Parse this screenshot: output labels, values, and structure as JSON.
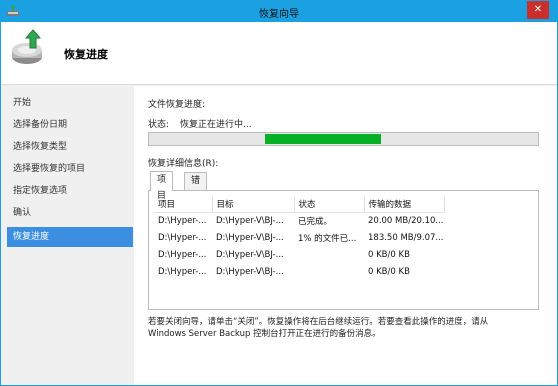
{
  "window": {
    "title": "恢复向导",
    "close_glyph": "✕"
  },
  "header": {
    "title": "恢复进度",
    "icon": "backup-restore-icon"
  },
  "sidebar": {
    "items": [
      {
        "label": "开始",
        "active": false
      },
      {
        "label": "选择备份日期",
        "active": false
      },
      {
        "label": "选择恢复类型",
        "active": false
      },
      {
        "label": "选择要恢复的项目",
        "active": false
      },
      {
        "label": "指定恢复选项",
        "active": false
      },
      {
        "label": "确认",
        "active": false
      },
      {
        "label": "恢复进度",
        "active": true
      }
    ]
  },
  "main": {
    "section_title": "文件恢复进度:",
    "status_label": "状态:",
    "status_value": "恢复正在进行中...",
    "progress_fraction": 0.3,
    "details_label": "恢复详细信息(R):",
    "tabs": [
      {
        "label": "项目",
        "active": true
      },
      {
        "label": "错误",
        "active": false
      }
    ],
    "table": {
      "headers": [
        "项目",
        "目标",
        "状态",
        "传输的数据"
      ],
      "rows": [
        [
          "D:\\Hyper-...",
          "D:\\Hyper-V\\BJ-...",
          "已完成。",
          "20.00 MB/20.10..."
        ],
        [
          "D:\\Hyper-...",
          "D:\\Hyper-V\\BJ-...",
          "1% 的文件已...",
          "183.50 MB/9.07..."
        ],
        [
          "D:\\Hyper-...",
          "D:\\Hyper-V\\BJ-...",
          "",
          "0 KB/0 KB"
        ],
        [
          "D:\\Hyper-...",
          "D:\\Hyper-V\\BJ-...",
          "",
          "0 KB/0 KB"
        ]
      ]
    },
    "footer_line1": "若要关闭向导，请单击“关闭”。恢复操作将在后台继续运行。若要查看此操作的进度，请从",
    "footer_line2": "Windows Server Backup 控制台打开正在进行的备份消息。"
  },
  "colors": {
    "titlebar": "#1ba1e2",
    "active_nav": "#3c8fe0",
    "progress": "#06b025",
    "close": "#c9302c"
  }
}
